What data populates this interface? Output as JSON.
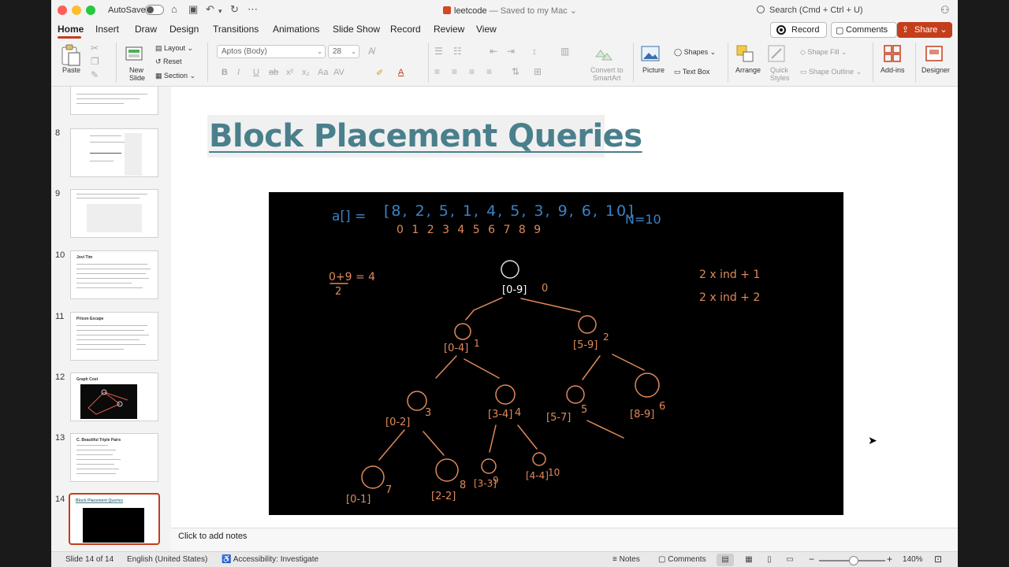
{
  "titlebar": {
    "autosave_label": "AutoSave",
    "doc_name": "leetcode",
    "doc_status": "— Saved to my Mac",
    "search_placeholder": "Search (Cmd + Ctrl + U)"
  },
  "tabs": [
    {
      "label": "Home",
      "active": true
    },
    {
      "label": "Insert"
    },
    {
      "label": "Draw"
    },
    {
      "label": "Design"
    },
    {
      "label": "Transitions"
    },
    {
      "label": "Animations"
    },
    {
      "label": "Slide Show"
    },
    {
      "label": "Record"
    },
    {
      "label": "Review"
    },
    {
      "label": "View"
    }
  ],
  "actions": {
    "record": "Record",
    "comments": "Comments",
    "share": "Share"
  },
  "ribbon": {
    "paste": "Paste",
    "new_slide": "New",
    "new_slide_2": "Slide",
    "layout": "Layout",
    "reset": "Reset",
    "section": "Section",
    "font_name": "Aptos (Body)",
    "font_size": "28",
    "convert_smartart": "Convert to",
    "convert_smartart_2": "SmartArt",
    "picture": "Picture",
    "shapes": "Shapes",
    "text_box": "Text Box",
    "arrange": "Arrange",
    "quick_styles": "Quick",
    "quick_styles_2": "Styles",
    "shape_fill": "Shape Fill",
    "shape_outline": "Shape Outline",
    "addins": "Add-ins",
    "designer": "Designer"
  },
  "thumbnails": [
    {
      "num": "8",
      "title": ""
    },
    {
      "num": "9",
      "title": ""
    },
    {
      "num": "10",
      "title": "Jovi Tim"
    },
    {
      "num": "11",
      "title": "Prison Escape"
    },
    {
      "num": "12",
      "title": "Graph Cost"
    },
    {
      "num": "13",
      "title": "C. Beautiful Triple Pairs"
    },
    {
      "num": "14",
      "title": "Block Placement Queries",
      "selected": true
    }
  ],
  "slide": {
    "title": "Block Placement Queries",
    "handwriting": {
      "array_label": "a[] =",
      "array_values": "[8, 2, 5, 1, 4, 5, 3, 9, 6, 10]",
      "array_indices": "0 1 2 3 4 5 6 7 8 9",
      "n_label": "N=10",
      "mid_formula_top": "0+9 = 4",
      "mid_formula_bottom": "2",
      "left_child_rule": "2 x ind + 1",
      "right_child_rule": "2 x ind + 2",
      "nodes": [
        {
          "range": "[0-9]",
          "index": "0"
        },
        {
          "range": "[0-4]",
          "index": "1"
        },
        {
          "range": "[5-9]",
          "index": "2"
        },
        {
          "range": "[0-2]",
          "index": "3"
        },
        {
          "range": "[3-4]",
          "index": "4"
        },
        {
          "range": "[5-7]",
          "index": "5"
        },
        {
          "range": "[8-9]",
          "index": "6"
        },
        {
          "range": "[0-1]",
          "index": "7"
        },
        {
          "range": "[2-2]",
          "index": "8"
        },
        {
          "range": "[3-3]",
          "index": "9"
        },
        {
          "range": "[4-4]",
          "index": "10"
        }
      ]
    }
  },
  "notes_placeholder": "Click to add notes",
  "status": {
    "slide_of": "Slide 14 of 14",
    "language": "English (United States)",
    "accessibility": "Accessibility: Investigate",
    "notes": "Notes",
    "comments": "Comments",
    "zoom": "140%"
  },
  "colors": {
    "accent": "#c43e1c",
    "title_teal": "#4a7f8c",
    "ink_blue": "#3b82c4",
    "ink_orange": "#e08a5a"
  }
}
